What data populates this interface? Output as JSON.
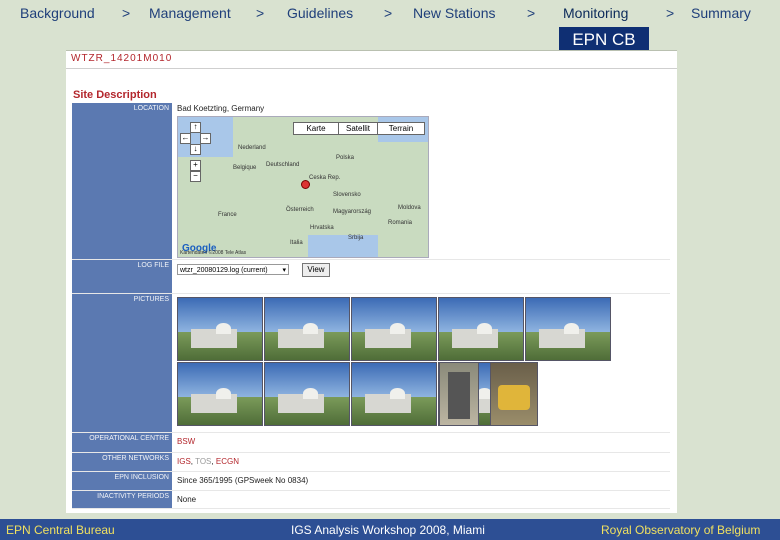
{
  "nav": {
    "items": [
      "Background",
      "Management",
      "Guidelines",
      "New Stations",
      "Monitoring",
      "Summary"
    ],
    "separator": ">"
  },
  "badge": "EPN CB",
  "station_id": "WTZR_14201M010",
  "section_title": "Site Description",
  "location": {
    "label": "LOCATION",
    "value": "Bad Koetzting, Germany",
    "map": {
      "types": [
        "Karte",
        "Satellit",
        "Terrain"
      ],
      "controls": [
        "↑",
        "←",
        "→",
        "↓",
        "+",
        "−"
      ],
      "labels": [
        "Nederland",
        "Deutschland",
        "Belgique",
        "Polska",
        "France",
        "Slovensko",
        "Österreich",
        "Magyarország",
        "Hrvatska",
        "Srbija",
        "Italia",
        "Moldova",
        "Romania"
      ],
      "pin_label": "Ceska Rep.",
      "logo": "Google",
      "copyright": "Kartendaten ©2008 Tele Atlas"
    }
  },
  "log_file": {
    "label": "LOG FILE",
    "selected": "wtzr_20080129.log (current)",
    "button": "View"
  },
  "pictures": {
    "label": "PICTURES",
    "items": [
      "site-photo-1",
      "site-photo-2",
      "site-photo-3",
      "site-photo-4",
      "site-photo-5",
      "site-photo-6",
      "site-photo-7",
      "site-photo-8",
      "site-photo-9",
      "equipment-rack-photo",
      "receiver-photo"
    ]
  },
  "operational_centre": {
    "label": "OPERATIONAL CENTRE",
    "value": "BSW"
  },
  "other_networks": {
    "label": "OTHER NETWORKS",
    "values": [
      "IGS",
      "TOS",
      "ECGN"
    ]
  },
  "epn_inclusion": {
    "label": "EPN INCLUSION",
    "value": "Since 365/1995 (GPSweek No 0834)"
  },
  "inactivity_periods": {
    "label": "INACTIVITY PERIODS",
    "value": "None"
  },
  "footer": {
    "left": "EPN Central Bureau",
    "center": "IGS Analysis Workshop 2008, Miami",
    "right": "Royal Observatory of Belgium"
  },
  "colors": {
    "footer_bg": "#2d4f94",
    "label_bg": "#5b79b1",
    "accent_red": "#b3262c",
    "badge_bg": "#0f2f73"
  }
}
